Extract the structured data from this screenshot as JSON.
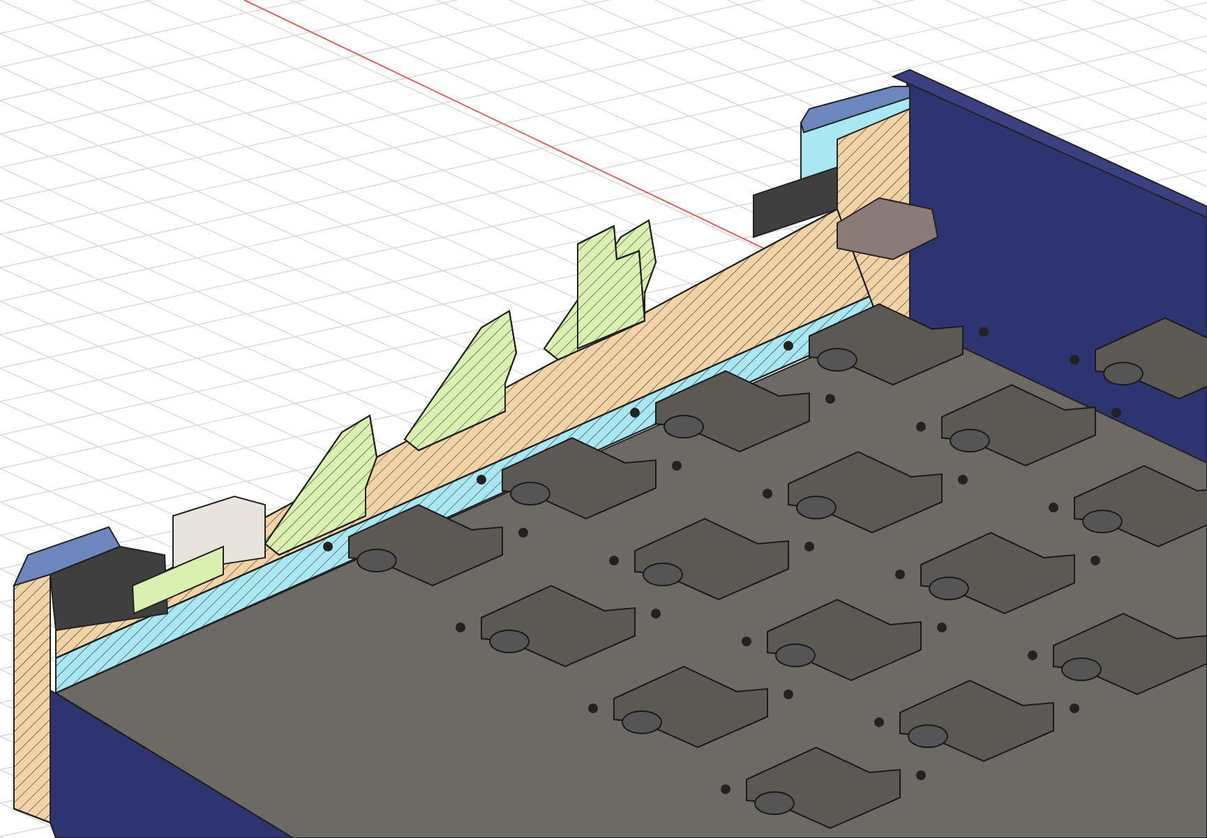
{
  "viewport": {
    "kind": "section-view"
  }
}
